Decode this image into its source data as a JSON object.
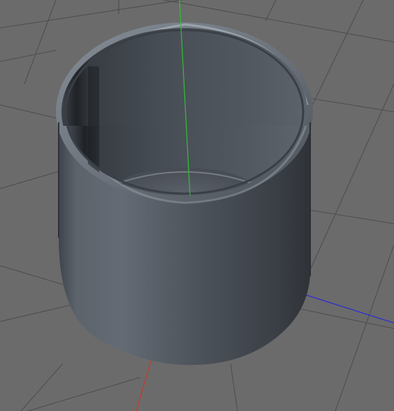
{
  "viewport": {
    "background_color": "#6b6b6b",
    "grid_color": "#4e4e4e",
    "axis_colors": {
      "x": "#c83a2a",
      "y": "#2ec234",
      "z": "#2b2bd4"
    }
  },
  "object": {
    "type": "cylinder-tube",
    "color": "#5a6068",
    "highlight_color": "#9aa2ab",
    "shadow_color": "#2d3136"
  }
}
